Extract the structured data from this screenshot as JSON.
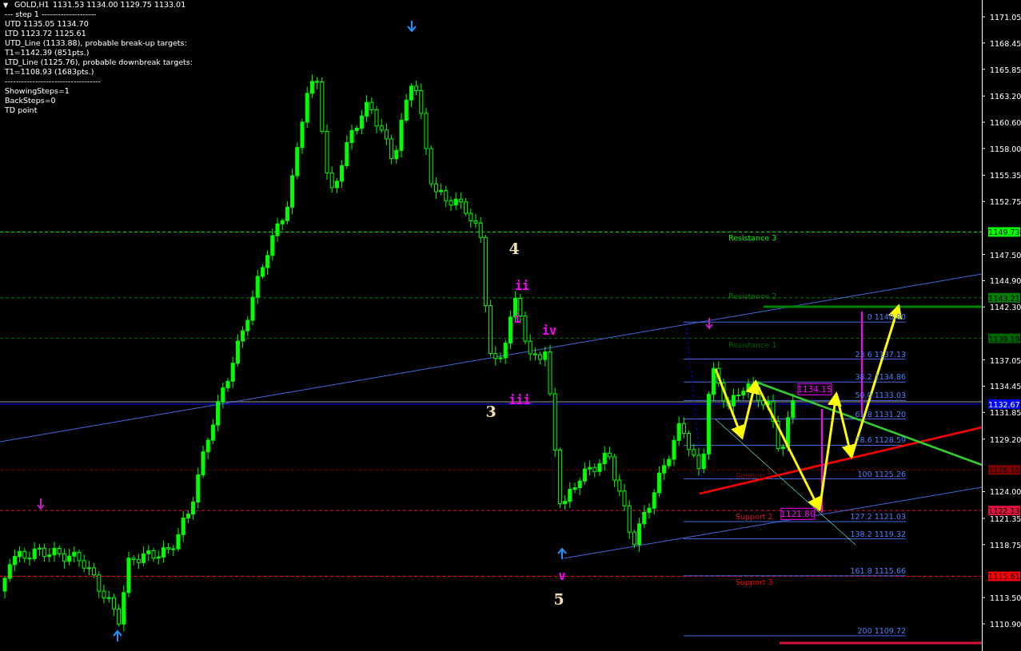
{
  "header": {
    "collapse_icon": "▼",
    "symbol": "GOLD,H1",
    "ohlc": "1131.53 1134.00 1129.75 1133.01"
  },
  "info_lines": [
    "---   step 1   --------------------",
    "UTD 1135.05  1134.70",
    "LTD  1123.72  1125.61",
    "UTD_Line (1133.88), probable break-up targets:",
    "T1=1142.39 (851pts.)",
    "LTD_Line (1125.76), probable downbreak targets:",
    "T1=1108.93 (1683pts.)",
    "-----------------------------------",
    "ShowingSteps=1",
    "BackSteps=0",
    "TD point"
  ],
  "price_axis": {
    "ticks": [
      "1171.05",
      "1168.45",
      "1165.85",
      "1163.20",
      "1160.60",
      "1158.00",
      "1155.35",
      "1152.75",
      "1147.50",
      "1144.90",
      "1142.30",
      "1137.05",
      "1134.45",
      "1131.85",
      "1129.20",
      "1124.00",
      "1121.35",
      "1118.75",
      "1113.50",
      "1110.90"
    ],
    "current_price": "1132.67"
  },
  "levels": [
    {
      "label": "Resistance 3",
      "tag": "1149.73",
      "color": "#00ff00"
    },
    {
      "label": "Resistance 2",
      "tag": "1143.21",
      "color": "#008000"
    },
    {
      "label": "Resistance 1",
      "tag": "1139.19",
      "color": "#006400"
    },
    {
      "label": "Support 1",
      "tag": "1126.15",
      "color": "#800000"
    },
    {
      "label": "Support 2",
      "tag": "1122.13",
      "color": "#dc143c"
    },
    {
      "label": "Support 3",
      "tag": "1115.61",
      "color": "#ff0000"
    }
  ],
  "fib_levels": [
    "0 1140.80",
    "23.6 1137.13",
    "38.2 1134.86",
    "50.0 1133.03",
    "61.8 1131.20",
    "78.6 1128.59",
    "100 1125.26",
    "127.2 1121.03",
    "138.2 1119.32",
    "161.8 1115.66",
    "200 1109.72"
  ],
  "wave_labels": [
    {
      "text": "4",
      "kind": "major"
    },
    {
      "text": "3",
      "kind": "major"
    },
    {
      "text": "5",
      "kind": "major"
    },
    {
      "text": "ii",
      "kind": "minor"
    },
    {
      "text": "i",
      "kind": "minor"
    },
    {
      "text": "iv",
      "kind": "minor"
    },
    {
      "text": "iii",
      "kind": "minor"
    },
    {
      "text": "v",
      "kind": "minor"
    }
  ],
  "price_boxes": [
    "1134.15",
    "1121.80"
  ]
}
